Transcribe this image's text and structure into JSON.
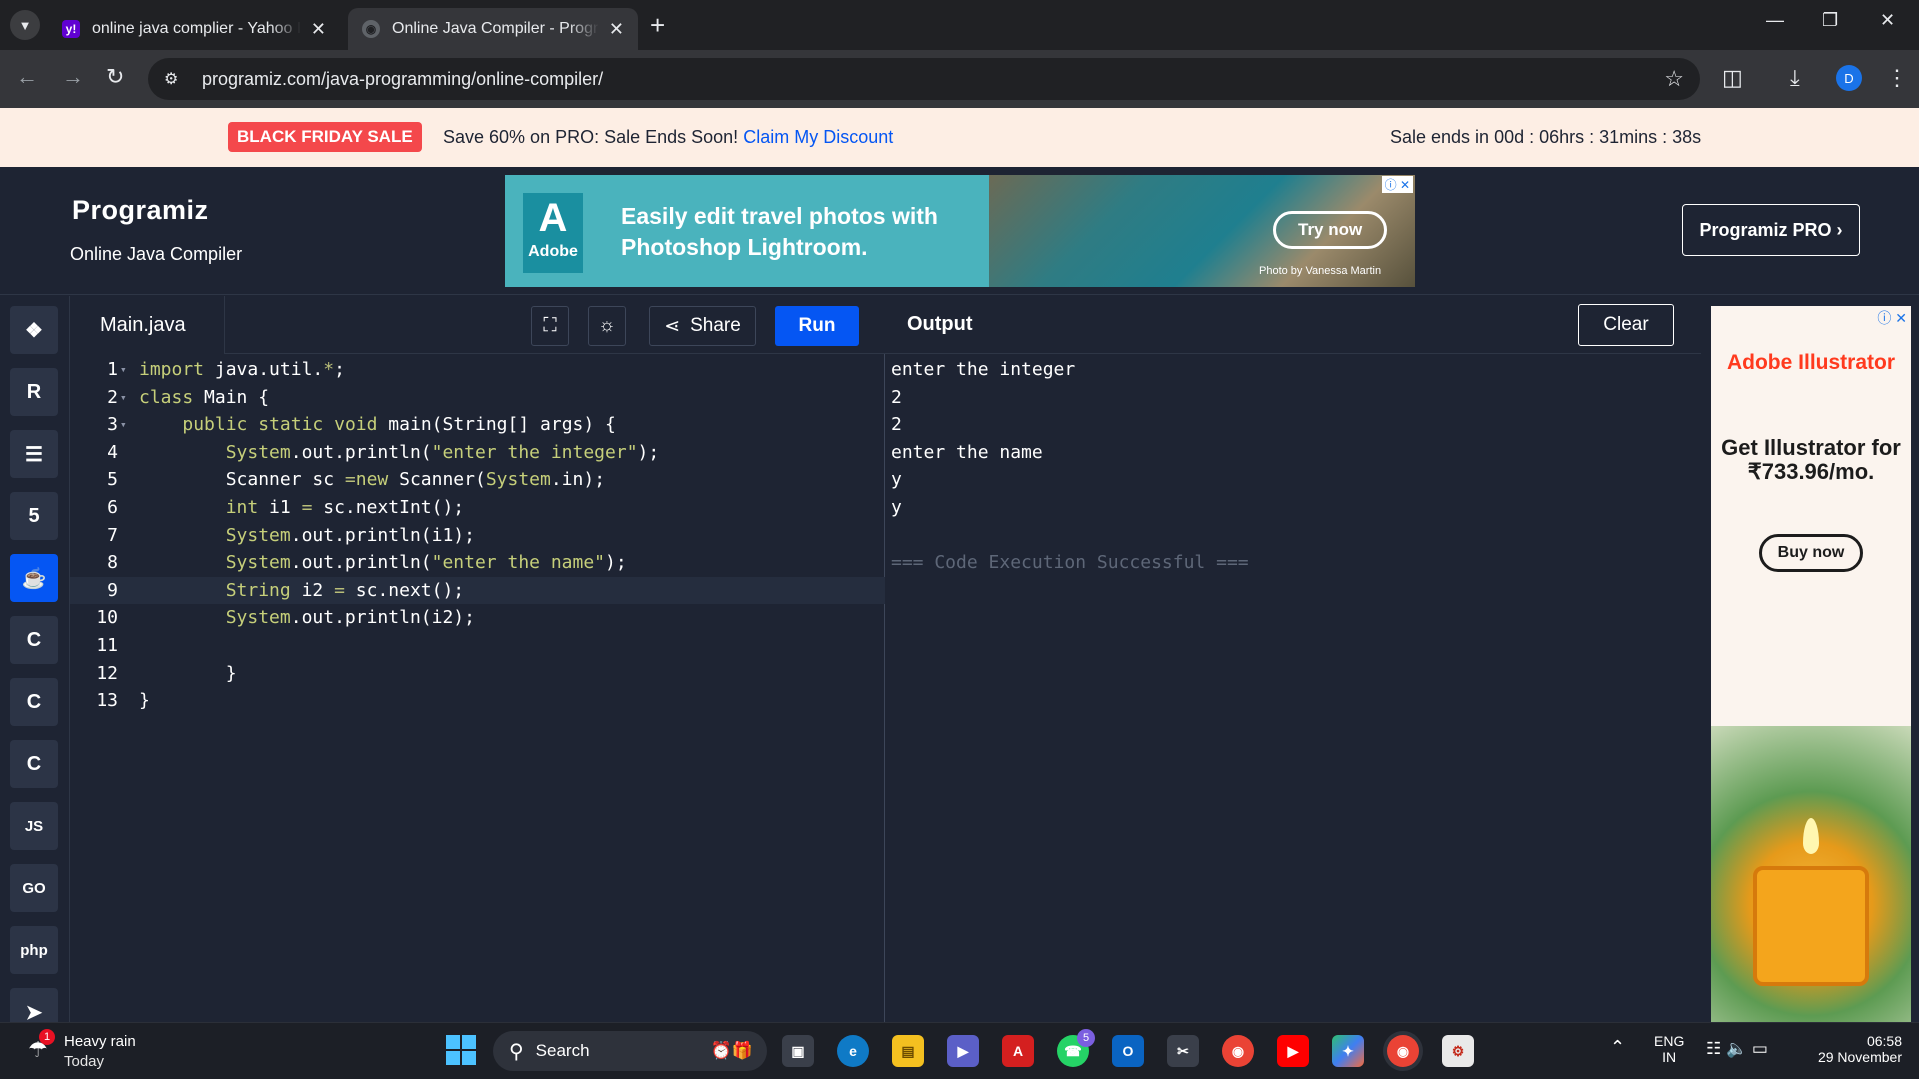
{
  "browser": {
    "tabs": [
      {
        "title": "online java complier - Yahoo In",
        "active": false
      },
      {
        "title": "Online Java Compiler - Progran",
        "active": true
      }
    ],
    "url": "programiz.com/java-programming/online-compiler/",
    "profile_initial": "D"
  },
  "promo": {
    "badge": "BLACK FRIDAY SALE",
    "message": "Save 60% on PRO: Sale Ends Soon!",
    "link": "Claim My Discount",
    "timer": "Sale ends in 00d : 06hrs : 31mins : 38s"
  },
  "header": {
    "logo": "Programiz",
    "subtitle": "Online Java Compiler",
    "pro_button": "Programiz PRO ›"
  },
  "ad_top": {
    "brand": "Adobe",
    "headline": "Easily edit travel photos with Photoshop Lightroom.",
    "cta": "Try now",
    "credit": "Photo by Vanessa Martin"
  },
  "sidebar": {
    "languages": [
      {
        "name": "python",
        "glyph": "❖"
      },
      {
        "name": "r",
        "glyph": "R"
      },
      {
        "name": "sql",
        "glyph": "☰"
      },
      {
        "name": "html",
        "glyph": "5"
      },
      {
        "name": "java",
        "glyph": "☕",
        "active": true
      },
      {
        "name": "c",
        "glyph": "C"
      },
      {
        "name": "cpp",
        "glyph": "C"
      },
      {
        "name": "csharp",
        "glyph": "C"
      },
      {
        "name": "js",
        "glyph": "JS"
      },
      {
        "name": "go",
        "glyph": "GO"
      },
      {
        "name": "php",
        "glyph": "php"
      },
      {
        "name": "swift",
        "glyph": "➤"
      }
    ]
  },
  "editor": {
    "filename": "Main.java",
    "share_label": "Share",
    "run_label": "Run",
    "lines": [
      {
        "n": "1",
        "fold": true,
        "html": "<span class=\"kw\">import</span> java.util.<span class=\"op\">*</span>;"
      },
      {
        "n": "2",
        "fold": true,
        "html": "<span class=\"kw\">class</span> Main {"
      },
      {
        "n": "3",
        "fold": true,
        "html": "    <span class=\"kw\">public</span> <span class=\"kw\">static</span> <span class=\"kw\">void</span> main(String[] args) {"
      },
      {
        "n": "4",
        "html": "        <span class=\"kw\">System</span>.out.println(<span class=\"st\">\"enter the integer\"</span>);"
      },
      {
        "n": "5",
        "html": "        Scanner sc <span class=\"op\">=</span><span class=\"kw\">new</span> Scanner(<span class=\"kw\">System</span>.in);"
      },
      {
        "n": "6",
        "html": "        <span class=\"kw\">int</span> i1 <span class=\"op\">=</span> sc.nextInt();"
      },
      {
        "n": "7",
        "html": "        <span class=\"kw\">System</span>.out.println(i1);"
      },
      {
        "n": "8",
        "html": "        <span class=\"kw\">System</span>.out.println(<span class=\"st\">\"enter the name\"</span>);"
      },
      {
        "n": "9",
        "current": true,
        "html": "        <span class=\"kw\">String</span> i2 <span class=\"op\">=</span> sc.next();"
      },
      {
        "n": "10",
        "html": "        <span class=\"kw\">System</span>.out.println(i2);"
      },
      {
        "n": "11",
        "html": ""
      },
      {
        "n": "12",
        "html": "        }"
      },
      {
        "n": "13",
        "html": "}"
      }
    ]
  },
  "output": {
    "title": "Output",
    "clear_label": "Clear",
    "lines": [
      "enter the integer",
      "2",
      "2",
      "enter the name",
      "y",
      "y",
      "",
      "=== Code Execution Successful ==="
    ]
  },
  "ad_right": {
    "brand": "Adobe Illustrator",
    "offer": "Get Illustrator for ₹733.96/mo.",
    "cta": "Buy now"
  },
  "taskbar": {
    "weather_title": "Heavy rain",
    "weather_sub": "Today",
    "weather_badge": "1",
    "search_label": "Search",
    "whatsapp_badge": "5",
    "lang_line1": "ENG",
    "lang_line2": "IN",
    "time": "06:58",
    "date": "29 November"
  }
}
